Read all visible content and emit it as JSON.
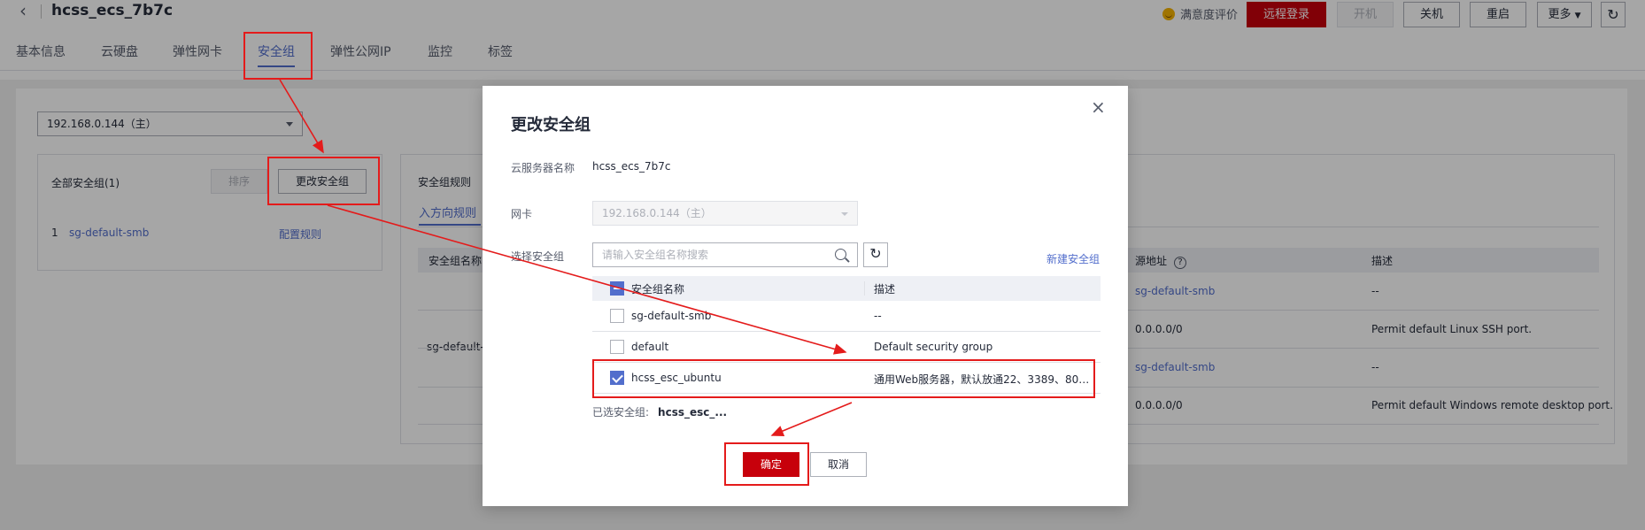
{
  "header": {
    "back_icon": "chevron-left-icon",
    "title": "hcss_ecs_7b7c",
    "satisfaction": "满意度评价",
    "buttons": {
      "remote_login": "远程登录",
      "power_on": "开机",
      "power_off": "关机",
      "restart": "重启",
      "more": "更多"
    },
    "refresh_icon": "refresh-icon",
    "colors": {
      "primary": "#c7000b",
      "link": "#526ecc"
    }
  },
  "tabs": [
    {
      "label": "基本信息"
    },
    {
      "label": "云硬盘"
    },
    {
      "label": "弹性网卡"
    },
    {
      "label": "安全组",
      "active": true
    },
    {
      "label": "弹性公网IP"
    },
    {
      "label": "监控"
    },
    {
      "label": "标签"
    }
  ],
  "background": {
    "nic_select": "192.168.0.144（主）",
    "all_sg_label": "全部安全组(1)",
    "sort_button": "排序",
    "change_sg_button": "更改安全组",
    "sg_list": [
      {
        "index": "1",
        "name": "sg-default-smb",
        "action": "配置规则"
      }
    ],
    "rules_title": "安全组规则",
    "inbound_tab": "入方向规则",
    "rules_columns": {
      "sg_name": "安全组名称",
      "source": "源地址",
      "desc": "描述"
    },
    "side_sg_name": "sg-default-s",
    "rules_rows": [
      {
        "source": "sg-default-smb",
        "source_is_link": true,
        "desc": "--"
      },
      {
        "source": "0.0.0.0/0",
        "source_is_link": false,
        "desc": "Permit default Linux SSH port."
      },
      {
        "source": "sg-default-smb",
        "source_is_link": true,
        "desc": "--"
      },
      {
        "source": "0.0.0.0/0",
        "source_is_link": false,
        "desc": "Permit default Windows remote desktop port."
      }
    ]
  },
  "modal": {
    "title": "更改安全组",
    "close_icon": "close-icon",
    "server_name_label": "云服务器名称",
    "server_name": "hcss_ecs_7b7c",
    "nic_label": "网卡",
    "nic_value": "192.168.0.144（主）",
    "select_sg_label": "选择安全组",
    "search_placeholder": "请输入安全组名称搜索",
    "new_sg_link": "新建安全组",
    "table_columns": {
      "name": "安全组名称",
      "desc": "描述"
    },
    "rows": [
      {
        "name": "sg-default-smb",
        "desc": "--",
        "checked": false
      },
      {
        "name": "default",
        "desc": "Default security group",
        "checked": false
      },
      {
        "name": "hcss_esc_ubuntu",
        "desc": "通用Web服务器，默认放通22、3389、80、…",
        "checked": true
      }
    ],
    "selected_label": "已选安全组:",
    "selected_value": "hcss_esc_...",
    "ok_button": "确定",
    "cancel_button": "取消"
  }
}
